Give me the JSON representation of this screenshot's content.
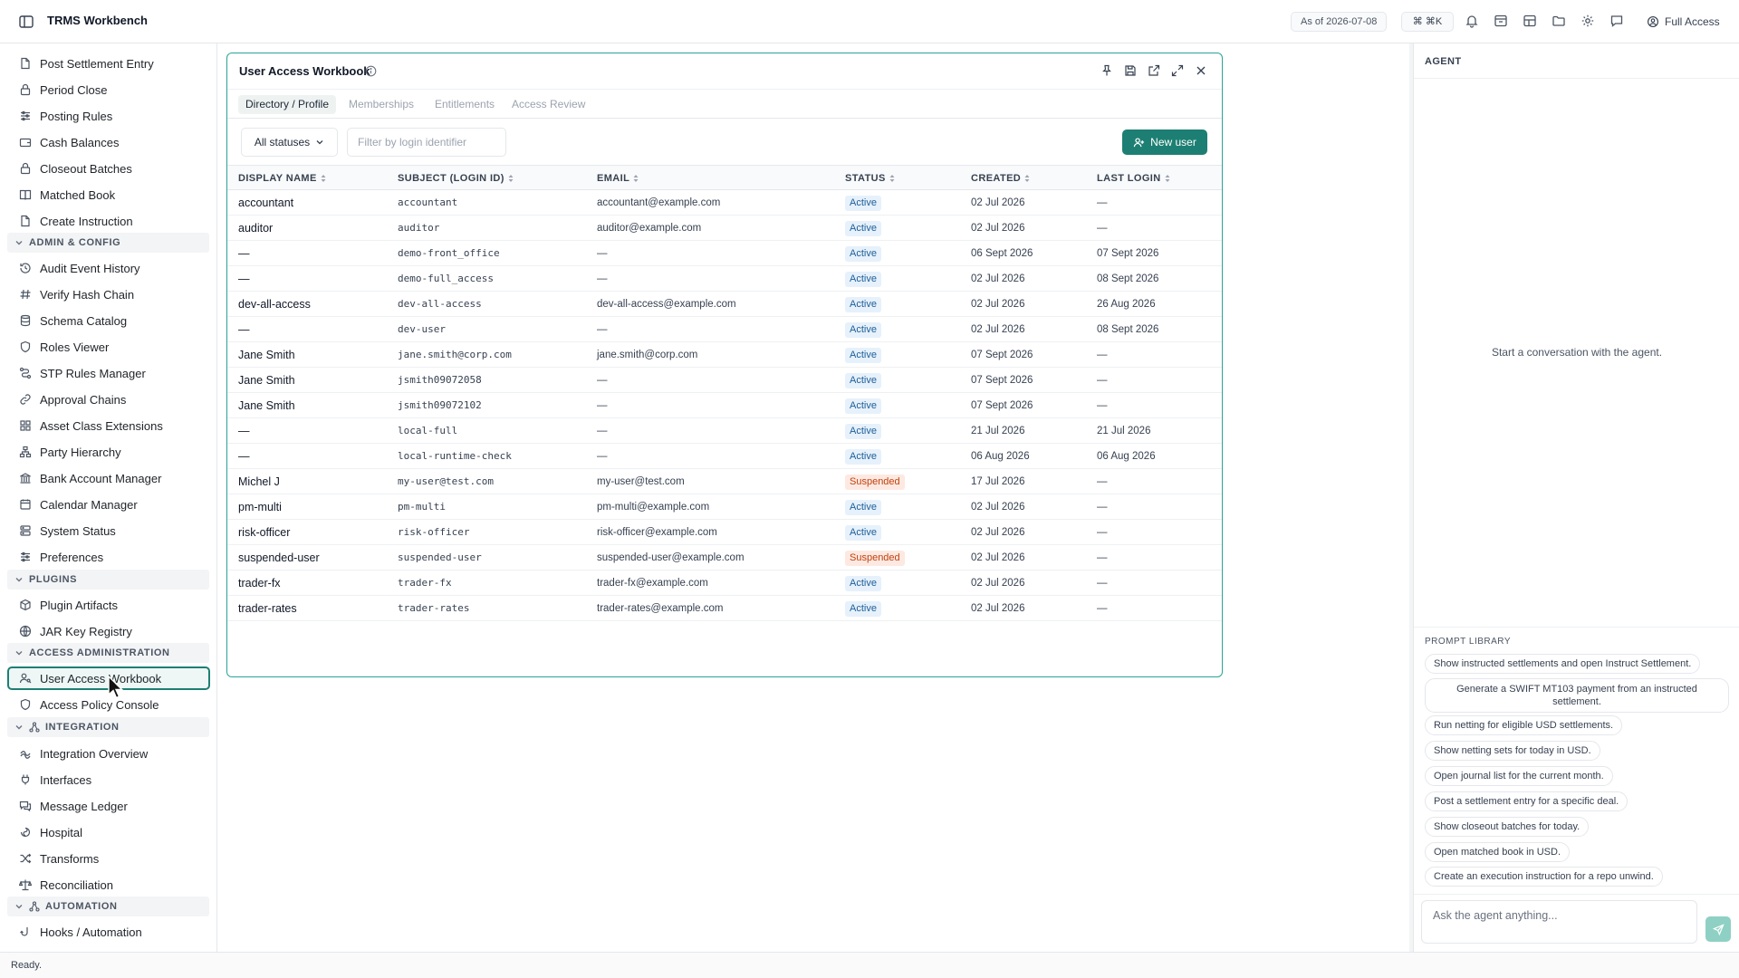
{
  "app": {
    "title": "TRMS Workbench"
  },
  "topbar": {
    "as_of": "As of 2026-07-08",
    "shortcut": "⌘ ⌘K",
    "access": "Full Access",
    "icons": [
      "bell-icon",
      "archive-icon",
      "layout-icon",
      "folder-icon",
      "gear-icon",
      "chat-icon"
    ]
  },
  "sidebar": {
    "items_top": [
      {
        "label": "Post Settlement Entry",
        "icon": "document-icon"
      },
      {
        "label": "Period Close",
        "icon": "lock-icon"
      },
      {
        "label": "Posting Rules",
        "icon": "sliders-icon"
      },
      {
        "label": "Cash Balances",
        "icon": "wallet-icon"
      },
      {
        "label": "Closeout Batches",
        "icon": "lock-icon"
      },
      {
        "label": "Matched Book",
        "icon": "book-icon"
      },
      {
        "label": "Create Instruction",
        "icon": "document-icon"
      }
    ],
    "admin_config": {
      "header": "ADMIN & CONFIG",
      "items": [
        {
          "label": "Audit Event History",
          "icon": "history-icon"
        },
        {
          "label": "Verify Hash Chain",
          "icon": "hash-icon"
        },
        {
          "label": "Schema Catalog",
          "icon": "database-icon"
        },
        {
          "label": "Roles Viewer",
          "icon": "shield-icon"
        },
        {
          "label": "STP Rules Manager",
          "icon": "flow-icon"
        },
        {
          "label": "Approval Chains",
          "icon": "link-icon"
        },
        {
          "label": "Asset Class Extensions",
          "icon": "grid-icon"
        },
        {
          "label": "Party Hierarchy",
          "icon": "hierarchy-icon"
        },
        {
          "label": "Bank Account Manager",
          "icon": "bank-icon"
        },
        {
          "label": "Calendar Manager",
          "icon": "calendar-icon"
        },
        {
          "label": "System Status",
          "icon": "server-icon"
        },
        {
          "label": "Preferences",
          "icon": "sliders-icon"
        }
      ]
    },
    "plugins": {
      "header": "PLUGINS",
      "items": [
        {
          "label": "Plugin Artifacts",
          "icon": "package-icon"
        },
        {
          "label": "JAR Key Registry",
          "icon": "globe-icon"
        }
      ]
    },
    "access_admin": {
      "header": "ACCESS ADMINISTRATION",
      "items": [
        {
          "label": "User Access Workbook",
          "icon": "user-key-icon"
        },
        {
          "label": "Access Policy Console",
          "icon": "shield-icon"
        }
      ]
    },
    "integration": {
      "header": "INTEGRATION",
      "items": [
        {
          "label": "Integration Overview",
          "icon": "network-icon"
        },
        {
          "label": "Interfaces",
          "icon": "plug-icon"
        },
        {
          "label": "Message Ledger",
          "icon": "messages-icon"
        },
        {
          "label": "Hospital",
          "icon": "hospital-icon"
        },
        {
          "label": "Transforms",
          "icon": "shuffle-icon"
        },
        {
          "label": "Reconciliation",
          "icon": "scale-icon"
        }
      ]
    },
    "automation": {
      "header": "AUTOMATION",
      "items": [
        {
          "label": "Hooks / Automation",
          "icon": "hook-icon"
        }
      ]
    }
  },
  "workbook": {
    "title": "User Access Workbook",
    "tabs": [
      "Directory / Profile",
      "Memberships",
      "Entitlements",
      "Access Review"
    ],
    "active_tab": "Directory / Profile",
    "status_filter": "All statuses",
    "search_placeholder": "Filter by login identifier",
    "new_user_label": "New user",
    "columns": [
      "DISPLAY NAME",
      "SUBJECT (LOGIN ID)",
      "EMAIL",
      "STATUS",
      "CREATED",
      "LAST LOGIN"
    ],
    "rows": [
      {
        "name": "accountant",
        "subject": "accountant",
        "email": "accountant@example.com",
        "status": "Active",
        "created": "02 Jul 2026",
        "last": "—"
      },
      {
        "name": "auditor",
        "subject": "auditor",
        "email": "auditor@example.com",
        "status": "Active",
        "created": "02 Jul 2026",
        "last": "—"
      },
      {
        "name": "—",
        "subject": "demo-front_office",
        "email": "—",
        "status": "Active",
        "created": "06 Sept 2026",
        "last": "07 Sept 2026"
      },
      {
        "name": "—",
        "subject": "demo-full_access",
        "email": "—",
        "status": "Active",
        "created": "02 Jul 2026",
        "last": "08 Sept 2026"
      },
      {
        "name": "dev-all-access",
        "subject": "dev-all-access",
        "email": "dev-all-access@example.com",
        "status": "Active",
        "created": "02 Jul 2026",
        "last": "26 Aug 2026"
      },
      {
        "name": "—",
        "subject": "dev-user",
        "email": "—",
        "status": "Active",
        "created": "02 Jul 2026",
        "last": "08 Sept 2026"
      },
      {
        "name": "Jane Smith",
        "subject": "jane.smith@corp.com",
        "email": "jane.smith@corp.com",
        "status": "Active",
        "created": "07 Sept 2026",
        "last": "—"
      },
      {
        "name": "Jane Smith",
        "subject": "jsmith09072058",
        "email": "—",
        "status": "Active",
        "created": "07 Sept 2026",
        "last": "—"
      },
      {
        "name": "Jane Smith",
        "subject": "jsmith09072102",
        "email": "—",
        "status": "Active",
        "created": "07 Sept 2026",
        "last": "—"
      },
      {
        "name": "—",
        "subject": "local-full",
        "email": "—",
        "status": "Active",
        "created": "21 Jul 2026",
        "last": "21 Jul 2026"
      },
      {
        "name": "—",
        "subject": "local-runtime-check",
        "email": "—",
        "status": "Active",
        "created": "06 Aug 2026",
        "last": "06 Aug 2026"
      },
      {
        "name": "Michel J",
        "subject": "my-user@test.com",
        "email": "my-user@test.com",
        "status": "Suspended",
        "created": "17 Jul 2026",
        "last": "—"
      },
      {
        "name": "pm-multi",
        "subject": "pm-multi",
        "email": "pm-multi@example.com",
        "status": "Active",
        "created": "02 Jul 2026",
        "last": "—"
      },
      {
        "name": "risk-officer",
        "subject": "risk-officer",
        "email": "risk-officer@example.com",
        "status": "Active",
        "created": "02 Jul 2026",
        "last": "—"
      },
      {
        "name": "suspended-user",
        "subject": "suspended-user",
        "email": "suspended-user@example.com",
        "status": "Suspended",
        "created": "02 Jul 2026",
        "last": "—"
      },
      {
        "name": "trader-fx",
        "subject": "trader-fx",
        "email": "trader-fx@example.com",
        "status": "Active",
        "created": "02 Jul 2026",
        "last": "—"
      },
      {
        "name": "trader-rates",
        "subject": "trader-rates",
        "email": "trader-rates@example.com",
        "status": "Active",
        "created": "02 Jul 2026",
        "last": "—"
      }
    ]
  },
  "agent": {
    "title": "AGENT",
    "empty_message": "Start a conversation with the agent.",
    "prompt_library_title": "PROMPT LIBRARY",
    "prompts": [
      "Show instructed settlements and open Instruct Settlement.",
      "Generate a SWIFT MT103 payment from an instructed settlement.",
      "Run netting for eligible USD settlements.",
      "Show netting sets for today in USD.",
      "Open journal list for the current month.",
      "Post a settlement entry for a specific deal.",
      "Show closeout batches for today.",
      "Open matched book in USD.",
      "Create an execution instruction for a repo unwind."
    ],
    "input_placeholder": "Ask the agent anything..."
  },
  "statusbar": {
    "text": "Ready."
  },
  "colors": {
    "accent": "#1d7f73",
    "active_badge": "#e6f1fb",
    "suspended_badge": "#fde9e2"
  }
}
